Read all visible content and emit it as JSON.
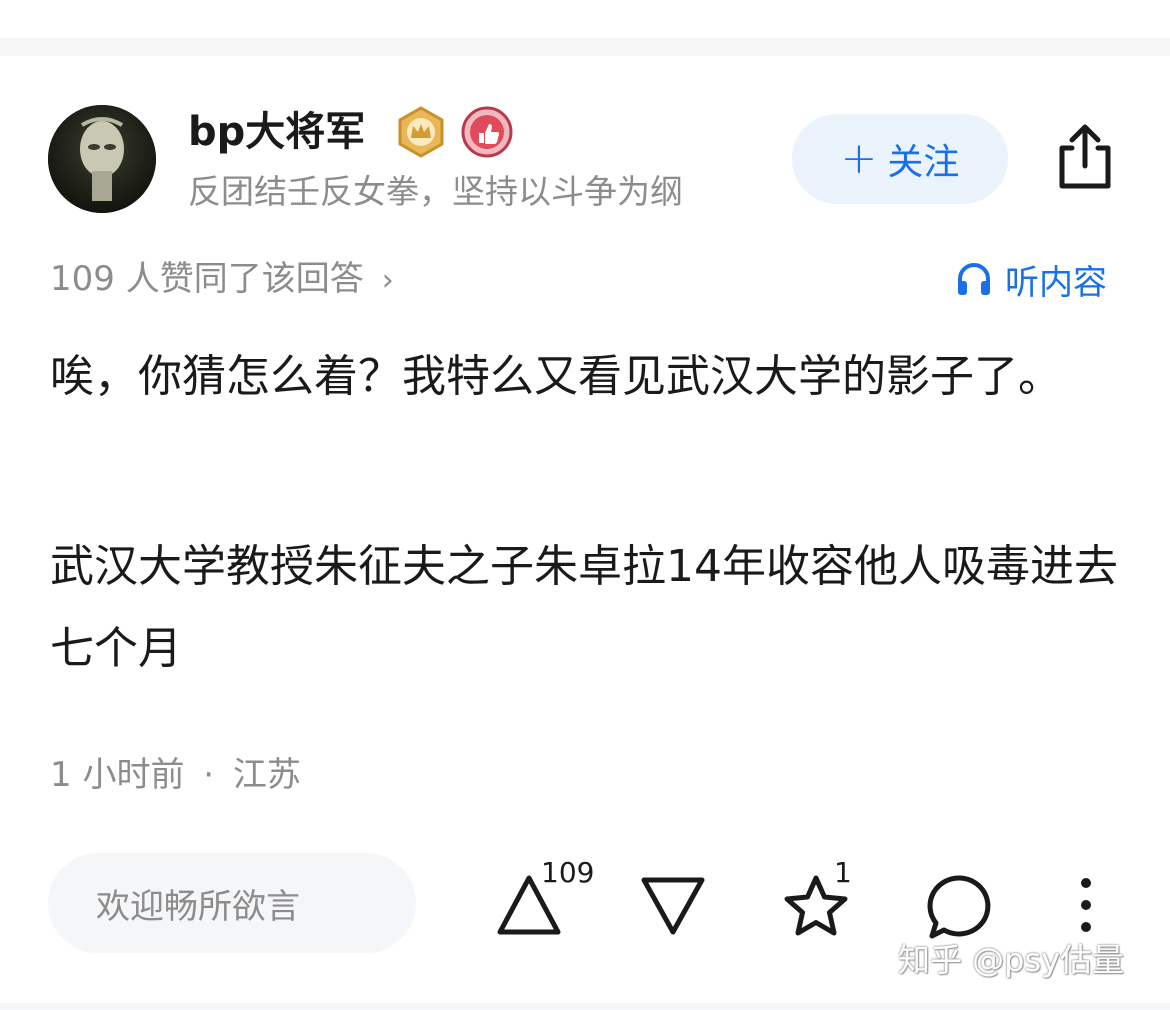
{
  "author": {
    "name": "bp大将军",
    "bio": "反团结壬反女拳，坚持以斗争为纲"
  },
  "badges": [
    {
      "icon": "crown-badge-icon",
      "color": "#d9a441"
    },
    {
      "icon": "thumbs-up-badge-icon",
      "color": "#e04a5a"
    }
  ],
  "follow": {
    "label": "关注",
    "icon": "plus-icon"
  },
  "share": {
    "icon": "share-icon"
  },
  "likes_summary": {
    "text": "109 人赞同了该回答",
    "chevron": "›"
  },
  "listen": {
    "label": "听内容",
    "icon": "headphones-icon"
  },
  "answer": {
    "paragraphs": [
      "唉，你猜怎么着？我特么又看见武汉大学的影子了。",
      "武汉大学教授朱征夫之子朱卓拉14年收容他人吸毒进去七个月"
    ]
  },
  "meta": {
    "time": "1 小时前",
    "separator": "·",
    "location": "江苏"
  },
  "comment": {
    "placeholder": "欢迎畅所欲言"
  },
  "actions": {
    "upvote": {
      "icon": "upvote-triangle-icon",
      "count": "109"
    },
    "downvote": {
      "icon": "downvote-triangle-icon"
    },
    "favorite": {
      "icon": "star-icon",
      "count": "1"
    },
    "comment": {
      "icon": "comment-bubble-icon"
    },
    "more": {
      "icon": "more-vertical-icon"
    }
  },
  "watermark": {
    "text": "知乎 @psy估量"
  },
  "colors": {
    "accent": "#1a70e8",
    "muted": "#8c8c8c",
    "follow_bg": "#ebf3fd",
    "input_bg": "#f5f6f8"
  }
}
